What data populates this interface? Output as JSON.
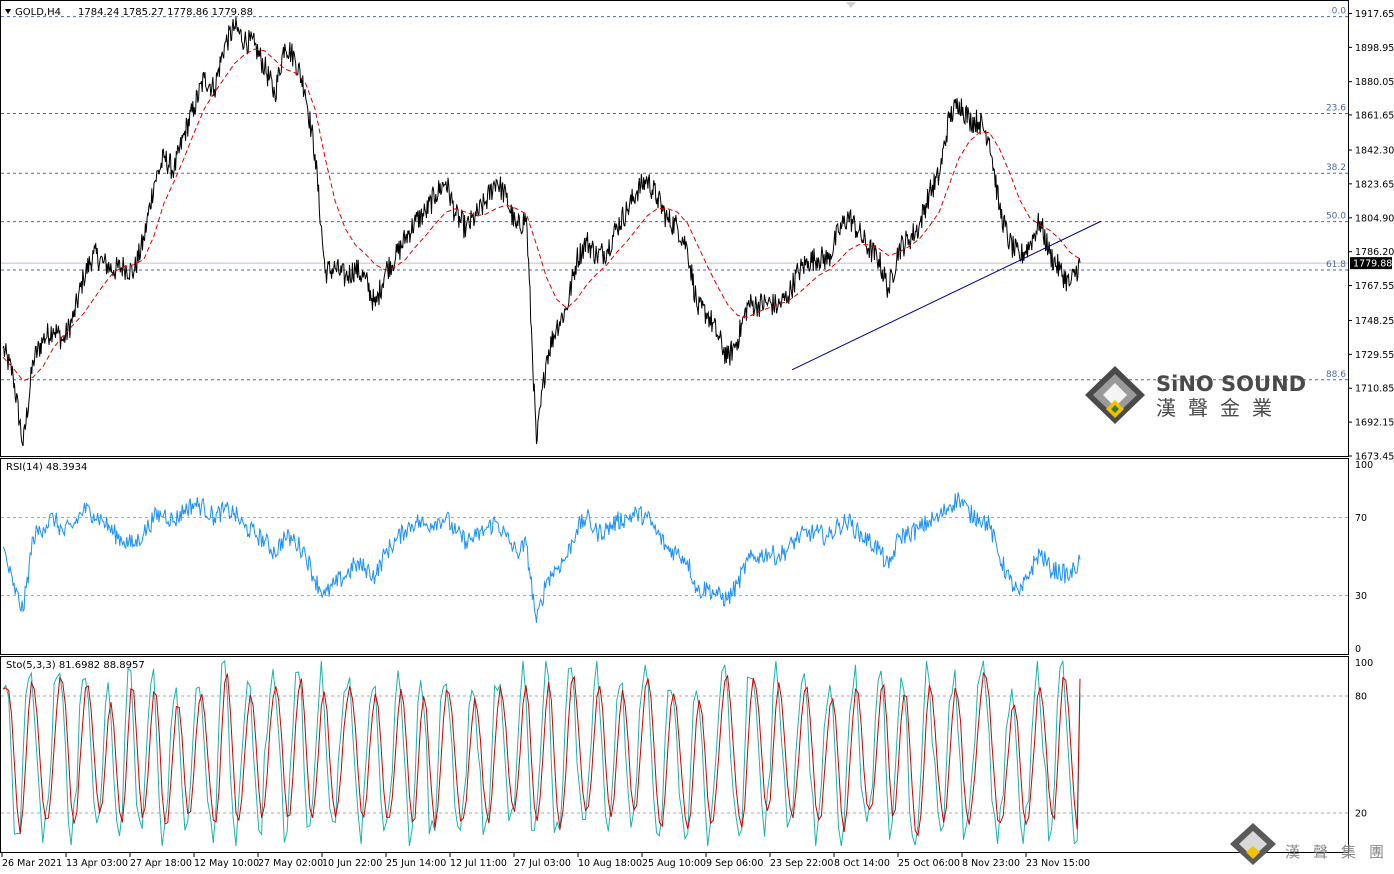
{
  "header": {
    "symbol_label": "GOLD,H4",
    "ohlc": "1784.24 1785.27 1778.86 1779.88"
  },
  "price_axis": {
    "ticks": [
      "1917.65",
      "1898.95",
      "1880.05",
      "1861.65",
      "1842.30",
      "1823.65",
      "1804.90",
      "1786.20",
      "1767.55",
      "1748.25",
      "1729.55",
      "1710.85",
      "1692.15",
      "1673.45"
    ],
    "current_price": "1779.88"
  },
  "fibonacci": {
    "levels": [
      {
        "label": "0.0",
        "price": 1915.9
      },
      {
        "label": "23.6",
        "price": 1862.5
      },
      {
        "label": "38.2",
        "price": 1829.5
      },
      {
        "label": "50.0",
        "price": 1802.8
      },
      {
        "label": "61.8",
        "price": 1776.1
      },
      {
        "label": "88.6",
        "price": 1715.5
      }
    ]
  },
  "rsi_panel": {
    "label": "RSI(14) 48.3934",
    "ticks": [
      "100",
      "70",
      "30",
      "0"
    ],
    "levels": [
      70,
      30
    ]
  },
  "stoch_panel": {
    "label": "Sto(5,3,3) 81.6982 88.8957",
    "ticks": [
      "100",
      "80",
      "20"
    ],
    "levels": [
      80,
      20
    ]
  },
  "time_axis": {
    "labels": [
      "26 Mar 2021",
      "13 Apr 03:00",
      "27 Apr 18:00",
      "12 May 10:00",
      "27 May 02:00",
      "10 Jun 22:00",
      "25 Jun 14:00",
      "12 Jul 11:00",
      "27 Jul 03:00",
      "10 Aug 18:00",
      "25 Aug 10:00",
      "9 Sep 06:00",
      "23 Sep 22:00",
      "8 Oct 14:00",
      "25 Oct 06:00",
      "8 Nov 23:00",
      "23 Nov 15:00"
    ]
  },
  "logo_main": {
    "name": "SiNO SOUND",
    "cjk": "漢聲金業"
  },
  "logo_small": {
    "cjk": "漢聲集團"
  },
  "colors": {
    "price": "#000000",
    "moving_average": "#e00000",
    "trendline": "#00008b",
    "rsi": "#1e90ff",
    "stoch_main": "#20b2aa",
    "stoch_signal": "#d00000",
    "fib_line": "#4a6aa5",
    "current_price_line": "#c0c0c0"
  },
  "chart_data": {
    "type": "line",
    "instrument": "GOLD",
    "timeframe": "H4",
    "ylim": [
      1673.45,
      1924.0
    ],
    "x_labels": [
      "26 Mar 2021",
      "13 Apr 03:00",
      "27 Apr 18:00",
      "12 May 10:00",
      "27 May 02:00",
      "10 Jun 22:00",
      "25 Jun 14:00",
      "12 Jul 11:00",
      "27 Jul 03:00",
      "10 Aug 18:00",
      "25 Aug 10:00",
      "9 Sep 06:00",
      "23 Sep 22:00",
      "8 Oct 14:00",
      "25 Oct 06:00",
      "8 Nov 23:00",
      "23 Nov 15:00"
    ],
    "series": [
      {
        "values": [
          1733,
          1718,
          1679,
          1726,
          1738,
          1744,
          1737,
          1750,
          1772,
          1785,
          1780,
          1776,
          1778,
          1775,
          1793,
          1824,
          1838,
          1831,
          1851,
          1866,
          1882,
          1876,
          1900,
          1910,
          1903,
          1900,
          1888,
          1873,
          1901,
          1893,
          1876,
          1840,
          1775,
          1777,
          1772,
          1777,
          1771,
          1756,
          1776,
          1783,
          1794,
          1803,
          1808,
          1818,
          1825,
          1806,
          1799,
          1806,
          1814,
          1826,
          1816,
          1799,
          1805,
          1680,
          1728,
          1745,
          1755,
          1782,
          1792,
          1784,
          1787,
          1800,
          1809,
          1820,
          1826,
          1816,
          1804,
          1800,
          1788,
          1755,
          1752,
          1740,
          1727,
          1738,
          1757,
          1757,
          1758,
          1756,
          1762,
          1775,
          1781,
          1783,
          1782,
          1797,
          1806,
          1797,
          1788,
          1782,
          1765,
          1788,
          1793,
          1800,
          1818,
          1828,
          1860,
          1869,
          1859,
          1858,
          1849,
          1810,
          1791,
          1783,
          1790,
          1803,
          1785,
          1776,
          1768,
          1780
        ]
      },
      {
        "values": [
          1728,
          1722,
          1715,
          1717,
          1723,
          1733,
          1740,
          1746,
          1752,
          1760,
          1768,
          1775,
          1778,
          1779,
          1782,
          1795,
          1813,
          1825,
          1838,
          1852,
          1865,
          1874,
          1882,
          1890,
          1895,
          1898,
          1897,
          1892,
          1887,
          1885,
          1880,
          1865,
          1838,
          1814,
          1799,
          1790,
          1785,
          1779,
          1776,
          1778,
          1782,
          1789,
          1795,
          1802,
          1808,
          1810,
          1808,
          1806,
          1807,
          1810,
          1812,
          1810,
          1807,
          1790,
          1772,
          1760,
          1755,
          1760,
          1768,
          1774,
          1779,
          1786,
          1792,
          1799,
          1806,
          1810,
          1810,
          1808,
          1802,
          1790,
          1778,
          1767,
          1757,
          1751,
          1750,
          1753,
          1755,
          1757,
          1759,
          1763,
          1768,
          1773,
          1776,
          1781,
          1787,
          1790,
          1790,
          1788,
          1784,
          1786,
          1789,
          1793,
          1800,
          1808,
          1823,
          1838,
          1847,
          1852,
          1852,
          1843,
          1830,
          1815,
          1805,
          1801,
          1798,
          1793,
          1786,
          1782
        ]
      }
    ],
    "trendline": {
      "from": {
        "x": "23 Sep 22:00",
        "y": 1721
      },
      "to": {
        "x": "23 Nov 15:00",
        "y": 1803
      }
    },
    "rsi": {
      "name": "RSI(14)",
      "last": 48.3934,
      "ylim": [
        0,
        100
      ],
      "values": [
        55,
        35,
        22,
        60,
        65,
        70,
        62,
        66,
        74,
        72,
        68,
        62,
        58,
        56,
        62,
        70,
        72,
        68,
        74,
        77,
        75,
        70,
        74,
        72,
        65,
        62,
        58,
        52,
        60,
        58,
        52,
        38,
        30,
        36,
        40,
        46,
        44,
        40,
        52,
        58,
        64,
        68,
        66,
        68,
        70,
        62,
        58,
        60,
        64,
        68,
        60,
        52,
        56,
        16,
        38,
        44,
        50,
        64,
        70,
        62,
        64,
        68,
        70,
        72,
        70,
        62,
        54,
        52,
        48,
        32,
        34,
        30,
        28,
        36,
        48,
        50,
        52,
        50,
        54,
        60,
        62,
        62,
        60,
        66,
        68,
        62,
        58,
        54,
        44,
        60,
        62,
        64,
        68,
        70,
        76,
        80,
        72,
        70,
        66,
        50,
        38,
        30,
        42,
        52,
        44,
        42,
        40,
        48
      ]
    },
    "stochastic": {
      "name": "Sto(5,3,3)",
      "main_last": 81.6982,
      "signal_last": 88.8957,
      "ylim": [
        0,
        100
      ]
    }
  }
}
